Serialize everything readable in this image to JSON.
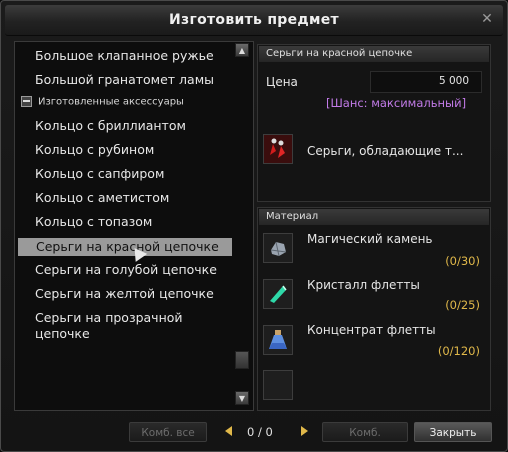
{
  "window": {
    "title": "Изготовить предмет",
    "close_glyph": "✕"
  },
  "list": {
    "items": [
      {
        "type": "item",
        "label": "Большое клапанное ружье"
      },
      {
        "type": "item",
        "label": "Большой гранатомет ламы"
      },
      {
        "type": "group",
        "label": "Изготовленные аксессуары"
      },
      {
        "type": "item",
        "label": "Кольцо с бриллиантом"
      },
      {
        "type": "item",
        "label": "Кольцо с рубином"
      },
      {
        "type": "item",
        "label": "Кольцо с сапфиром"
      },
      {
        "type": "item",
        "label": "Кольцо с аметистом"
      },
      {
        "type": "item",
        "label": "Кольцо с топазом"
      },
      {
        "type": "item",
        "label": "Серьги на красной цепочке",
        "selected": true
      },
      {
        "type": "item",
        "label": "Серьги на голубой цепочке"
      },
      {
        "type": "item",
        "label": "Серьги на желтой цепочке"
      },
      {
        "type": "item",
        "label": "Серьги на прозрачной"
      },
      {
        "type": "item",
        "label": "цепочке"
      }
    ],
    "scroll_up": "▲",
    "scroll_down": "▼"
  },
  "detail": {
    "header": "Серьги на красной цепочке",
    "price_label": "Цена",
    "price_value": "5 000",
    "chance": "[Шанс: максимальный]",
    "chance_color": "#c27be8",
    "result_name": "Серьги, обладающие т..."
  },
  "materials": {
    "header": "Материал",
    "count_color": "#e0b84a",
    "items": [
      {
        "name": "Магический камень",
        "count": "(0/30)",
        "icon": "magic-stone-icon"
      },
      {
        "name": "Кристалл флетты",
        "count": "(0/25)",
        "icon": "fletta-crystal-icon"
      },
      {
        "name": "Концентрат флетты",
        "count": "(0/120)",
        "icon": "fletta-concentrate-icon"
      }
    ]
  },
  "footer": {
    "combine_all": "Комб. все",
    "page": "0 / 0",
    "combine": "Комб.",
    "close": "Закрыть"
  }
}
